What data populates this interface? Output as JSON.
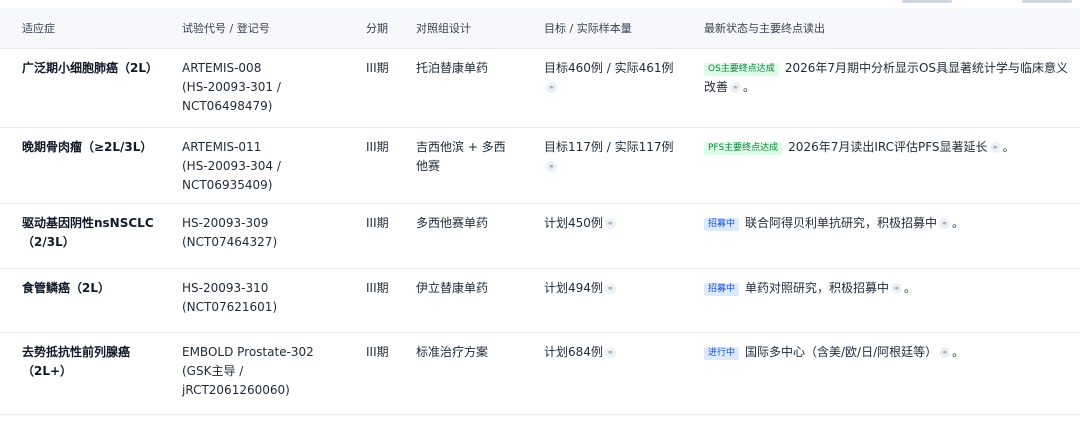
{
  "headers": [
    "适应症",
    "试验代号 / 登记号",
    "分期",
    "对照组设计",
    "目标 / 实际样本量",
    "最新状态与主要终点读出"
  ],
  "colors": {
    "badge_green_bg": "#dcfce7",
    "badge_green_text": "#15803d",
    "badge_blue_bg": "#dbeafe",
    "badge_blue_text": "#1d4ed8"
  },
  "icons": {
    "source_link": "link-icon"
  },
  "rows": [
    {
      "indication": [
        "广泛期小细胞肺癌（2L）"
      ],
      "registry": [
        "ARTEMIS-008",
        "(HS-20093-301 /",
        "NCT06498479)"
      ],
      "phase": "III期",
      "control": [
        "托泊替康单药"
      ],
      "sample": "目标460例 / 实际461例",
      "badge": "OS主要终点达成",
      "badge_color": "green",
      "status": "2026年7月期中分析显示OS具显著统计学与临床意义改善"
    },
    {
      "indication": [
        "晚期骨肉瘤（≥2L/3L）"
      ],
      "registry": [
        "ARTEMIS-011",
        "(HS-20093-304 /",
        "NCT06935409)"
      ],
      "phase": "III期",
      "control": [
        "吉西他滨 + 多西",
        "他赛"
      ],
      "sample": "目标117例 / 实际117例",
      "badge": "PFS主要终点达成",
      "badge_color": "green",
      "status": "2026年7月读出IRC评估PFS显著延长"
    },
    {
      "indication": [
        "驱动基因阴性nsNSCLC",
        "（2/3L）"
      ],
      "registry": [
        "HS-20093-309",
        "(NCT07464327)"
      ],
      "phase": "III期",
      "control": [
        "多西他赛单药"
      ],
      "sample": "计划450例",
      "badge": "招募中",
      "badge_color": "blue",
      "status": "联合阿得贝利单抗研究，积极招募中"
    },
    {
      "indication": [
        "食管鳞癌（2L）"
      ],
      "registry": [
        "HS-20093-310",
        "(NCT07621601)"
      ],
      "phase": "III期",
      "control": [
        "伊立替康单药"
      ],
      "sample": "计划494例",
      "badge": "招募中",
      "badge_color": "blue",
      "status": "单药对照研究，积极招募中"
    },
    {
      "indication": [
        "去势抵抗性前列腺癌",
        "（2L+）"
      ],
      "registry": [
        "EMBOLD Prostate-302",
        "(GSK主导 /",
        "jRCT2061260060)"
      ],
      "phase": "III期",
      "control": [
        "标准治疗方案"
      ],
      "sample": "计划684例",
      "badge": "进行中",
      "badge_color": "blue",
      "status": "国际多中心（含美/欧/日/阿根廷等）"
    }
  ]
}
